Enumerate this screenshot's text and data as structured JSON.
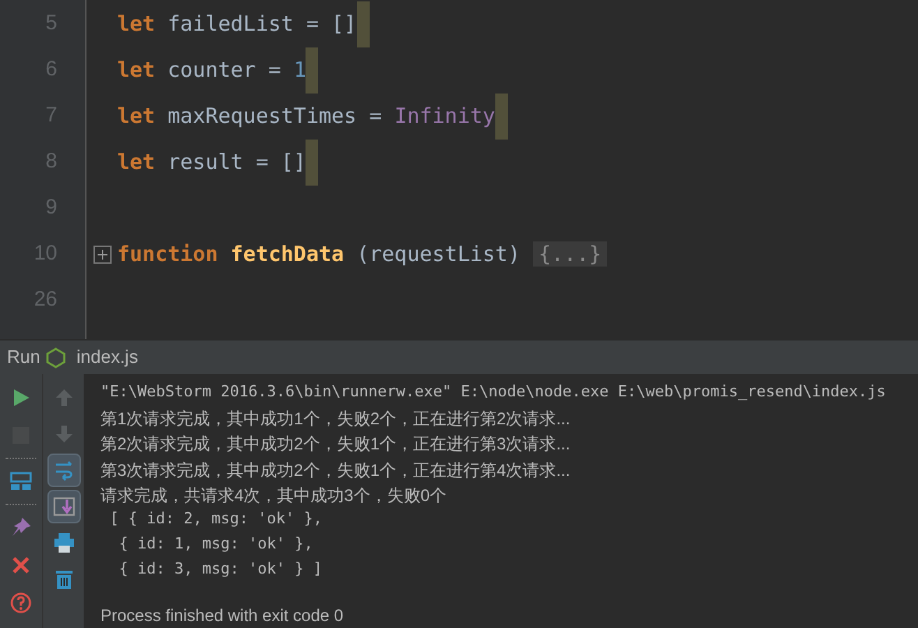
{
  "editor": {
    "lines": [
      {
        "number": "5",
        "tokens": [
          {
            "kind": "keyword",
            "text": "let"
          },
          {
            "kind": "ident",
            "text": " failedList = []"
          }
        ],
        "highlight": true
      },
      {
        "number": "6",
        "tokens": [
          {
            "kind": "keyword",
            "text": "let"
          },
          {
            "kind": "ident",
            "text": " counter = "
          },
          {
            "kind": "number",
            "text": "1"
          }
        ],
        "highlight": true
      },
      {
        "number": "7",
        "tokens": [
          {
            "kind": "keyword",
            "text": "let"
          },
          {
            "kind": "ident",
            "text": " maxRequestTimes = "
          },
          {
            "kind": "constant",
            "text": "Infinity"
          }
        ],
        "highlight": true
      },
      {
        "number": "8",
        "tokens": [
          {
            "kind": "keyword",
            "text": "let"
          },
          {
            "kind": "ident",
            "text": " result = []"
          }
        ],
        "highlight": true
      },
      {
        "number": "9",
        "highlight": false
      },
      {
        "number": "10",
        "tokens": [
          {
            "kind": "keyword",
            "text": "function"
          },
          {
            "kind": "function",
            "text": " fetchData"
          },
          {
            "kind": "ident",
            "text": " (requestList) "
          },
          {
            "kind": "folded",
            "text": "{...}"
          }
        ],
        "highlight": false,
        "foldable": true
      },
      {
        "number": "26",
        "highlight": false
      }
    ]
  },
  "run_panel": {
    "label": "Run",
    "file": "index.js",
    "left_tools": [
      {
        "kind": "run",
        "disabled": false
      },
      {
        "kind": "stop",
        "disabled": true
      },
      {
        "kind": "layout",
        "disabled": false
      },
      {
        "kind": "pin",
        "disabled": false
      },
      {
        "kind": "close",
        "disabled": false
      },
      {
        "kind": "help",
        "disabled": false
      }
    ],
    "right_tools": [
      {
        "kind": "up",
        "selected": false
      },
      {
        "kind": "down",
        "selected": false
      },
      {
        "kind": "wrap",
        "selected": true
      },
      {
        "kind": "scroll-end",
        "selected": true
      },
      {
        "kind": "print",
        "selected": false
      },
      {
        "kind": "trash",
        "selected": false
      }
    ],
    "console": [
      {
        "kind": "command",
        "text": "\"E:\\WebStorm 2016.3.6\\bin\\runnerw.exe\" E:\\node\\node.exe E:\\web\\promis_resend\\index.js"
      },
      {
        "kind": "output",
        "text": "第1次请求完成，其中成功1个，失败2个，正在进行第2次请求..."
      },
      {
        "kind": "output",
        "text": "第2次请求完成，其中成功2个，失败1个，正在进行第3次请求..."
      },
      {
        "kind": "output",
        "text": "第3次请求完成，其中成功2个，失败1个，正在进行第4次请求..."
      },
      {
        "kind": "output",
        "text": "请求完成，共请求4次，其中成功3个，失败0个"
      },
      {
        "kind": "code",
        "text": " [ { id: 2, msg: 'ok' },"
      },
      {
        "kind": "code",
        "text": "  { id: 1, msg: 'ok' },"
      },
      {
        "kind": "code",
        "text": "  { id: 3, msg: 'ok' } ]"
      },
      {
        "kind": "blank"
      },
      {
        "kind": "output",
        "text": "Process finished with exit code 0"
      }
    ]
  }
}
